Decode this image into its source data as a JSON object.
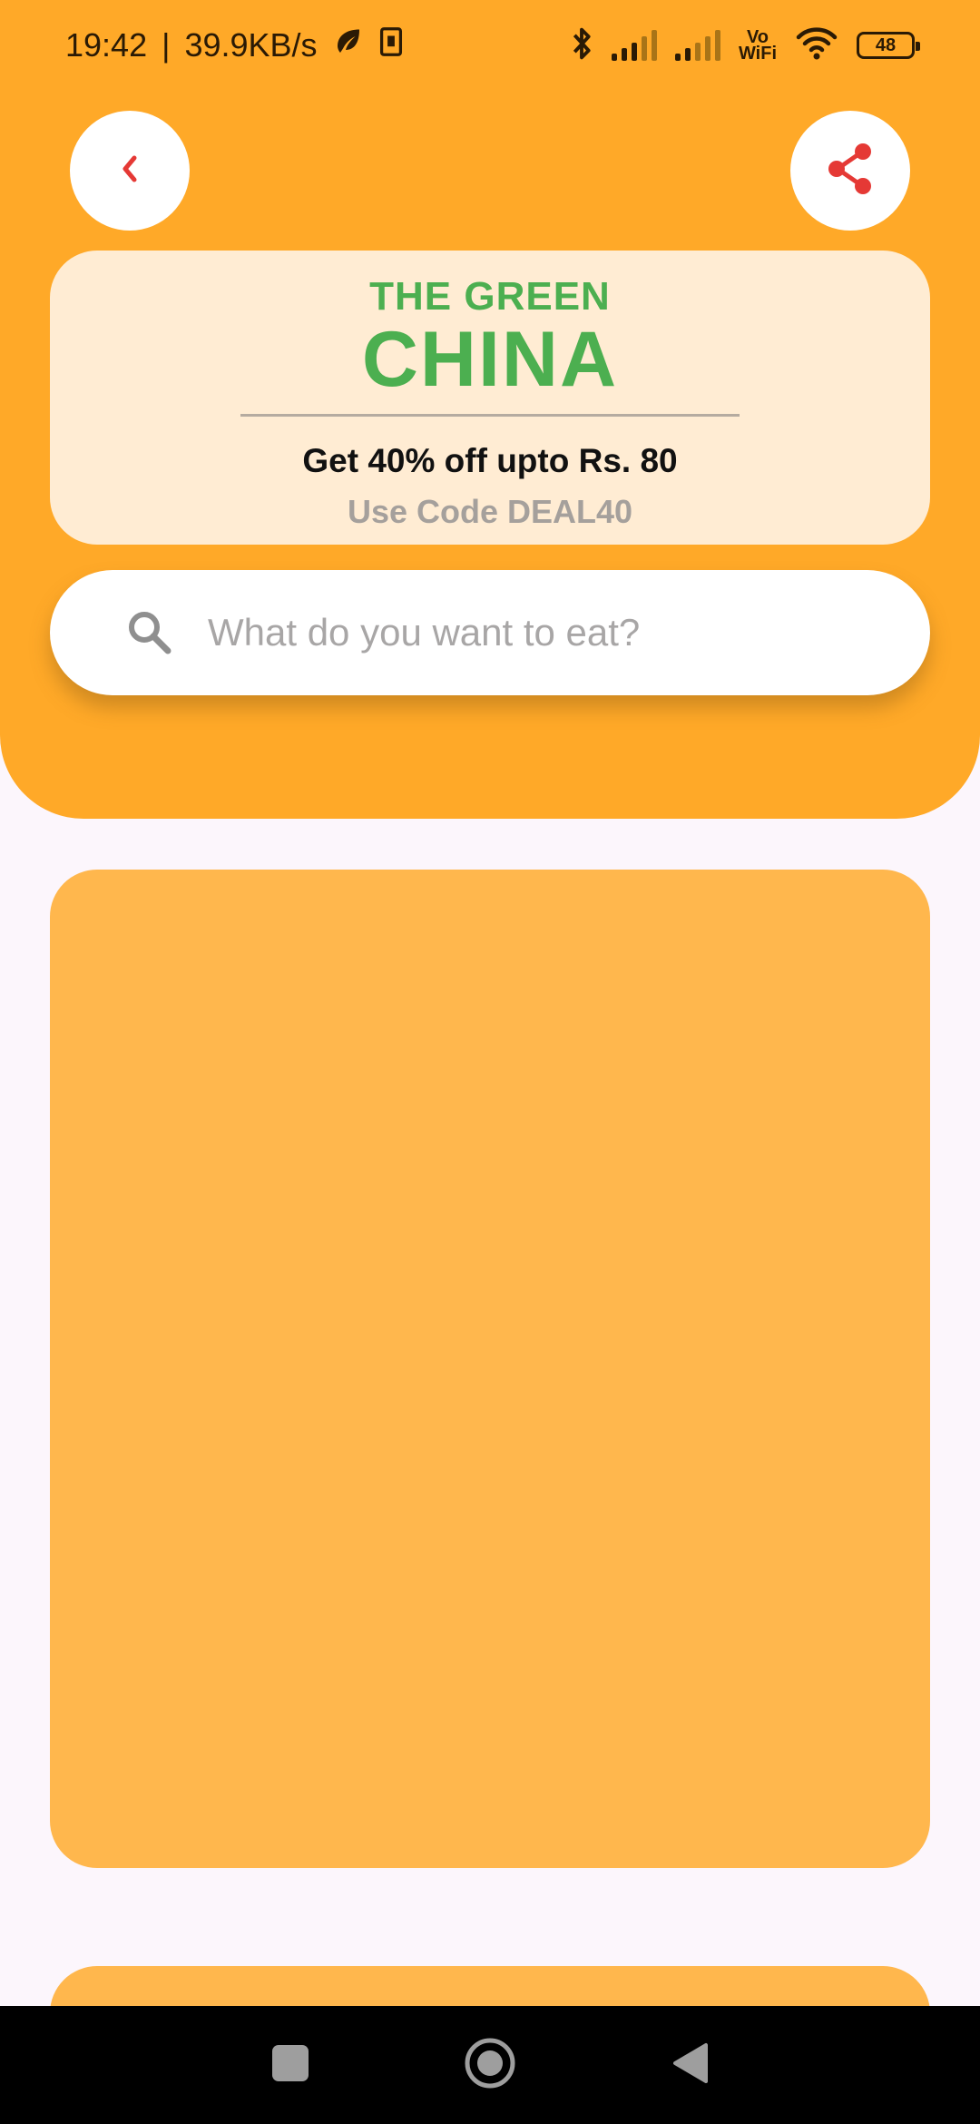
{
  "status_bar": {
    "time": "19:42",
    "separator": "|",
    "network_speed": "39.9KB/s",
    "battery": "48",
    "vowifi_top": "Vo",
    "vowifi_bottom": "WiFi",
    "icons": [
      "leaf-icon",
      "sim-card-icon",
      "bluetooth-icon",
      "signal-icon",
      "signal-icon",
      "wifi-icon",
      "battery-icon"
    ]
  },
  "header": {
    "back_icon": "chevron-left-icon",
    "share_icon": "share-icon",
    "accent_color": "#e53935"
  },
  "promo": {
    "brand_top": "THE GREEN",
    "brand_main": "CHINA",
    "offer": "Get 40% off upto Rs. 80",
    "code": "Use Code DEAL40",
    "brand_color": "#4caf50"
  },
  "search": {
    "placeholder": "What do you want to eat?",
    "value": "",
    "icon": "search-icon"
  },
  "colors": {
    "header_bg": "#ffa928",
    "card_bg": "#ffb74d",
    "promo_bg": "#ffecd3",
    "page_bg": "#fcf6fc"
  },
  "nav": {
    "items": [
      "recents-square-icon",
      "home-circle-icon",
      "back-triangle-icon"
    ]
  }
}
